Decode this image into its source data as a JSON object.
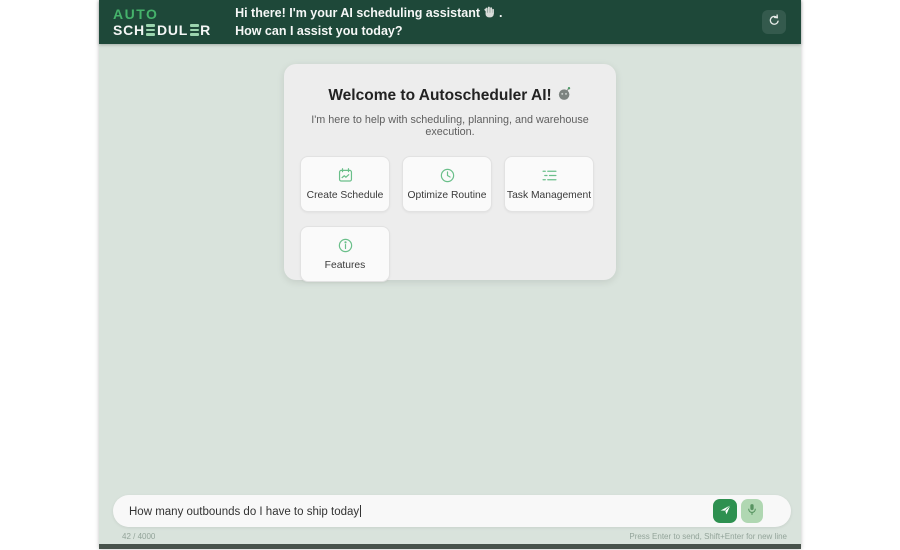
{
  "header": {
    "logo_line1": "AUTO",
    "logo_line2_a": "SCH",
    "logo_line2_b": "DUL",
    "logo_line2_c": "R",
    "greeting_line1": "Hi there! I'm your AI scheduling assistant",
    "greeting_line1_punct": ".",
    "greeting_line2": "How can I assist you today?"
  },
  "welcome_card": {
    "title": "Welcome to Autoscheduler AI!",
    "subtitle": "I'm here to help with scheduling, planning, and warehouse execution.",
    "actions": [
      {
        "label": "Create Schedule",
        "icon": "calendar-icon"
      },
      {
        "label": "Optimize Routine",
        "icon": "clock-icon"
      },
      {
        "label": "Task Management",
        "icon": "task-list-icon"
      },
      {
        "label": "Features",
        "icon": "info-icon"
      }
    ]
  },
  "composer": {
    "input_value": "How many outbounds do I have to ship today",
    "char_counter": "42 / 4000",
    "hint": "Press Enter to send, Shift+Enter for new line"
  },
  "colors": {
    "header_green": "#1e4839",
    "logo_green": "#45b26b",
    "background_green": "#d9e3dc",
    "card_gray": "#ededed",
    "icon_green": "#6abf8a",
    "send_green": "#2e9050",
    "mic_light_green": "#b0d7b2"
  }
}
